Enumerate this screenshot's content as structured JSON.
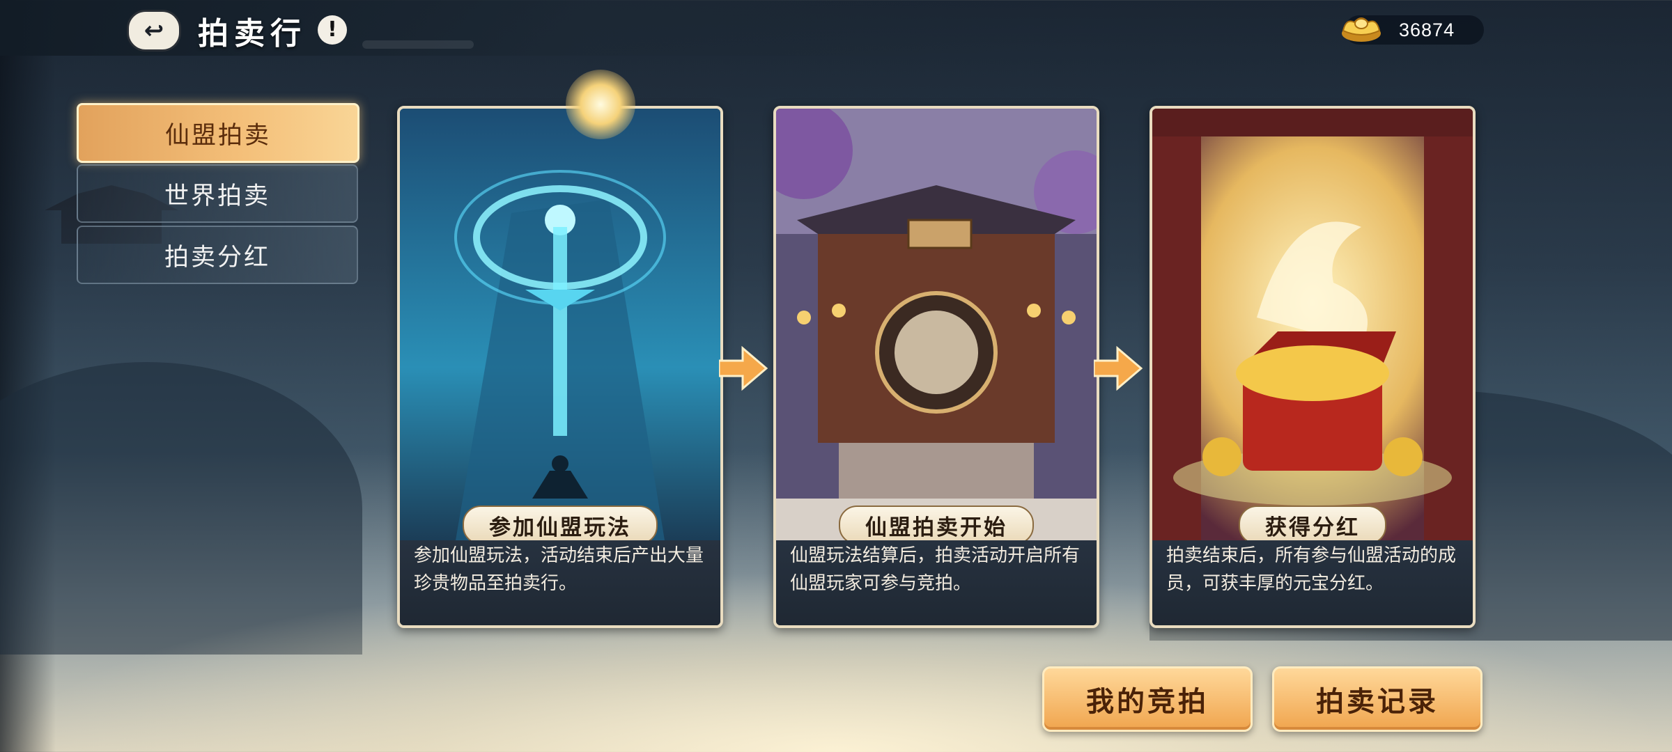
{
  "header": {
    "title": "拍卖行",
    "info_icon": "exclamation-icon",
    "back_icon": "back-arrow-icon"
  },
  "currency": {
    "icon": "gold-ingot-icon",
    "value": "36874"
  },
  "tabs": [
    {
      "label": "仙盟拍卖",
      "active": true
    },
    {
      "label": "世界拍卖",
      "active": false
    },
    {
      "label": "拍卖分红",
      "active": false
    }
  ],
  "cards": [
    {
      "label": "参加仙盟玩法",
      "desc": "参加仙盟玩法，活动结束后产出大量珍贵物品至拍卖行。"
    },
    {
      "label": "仙盟拍卖开始",
      "desc": "仙盟玩法结算后，拍卖活动开启所有仙盟玩家可参与竞拍。"
    },
    {
      "label": "获得分红",
      "desc": "拍卖结束后，所有参与仙盟活动的成员，可获丰厚的元宝分红。"
    }
  ],
  "buttons": {
    "my_bids": "我的竞拍",
    "records": "拍卖记录"
  },
  "colors": {
    "accent_gold": "#f0a54e",
    "active_tab": "#f4c07a",
    "card_border": "#e9dcc0"
  }
}
